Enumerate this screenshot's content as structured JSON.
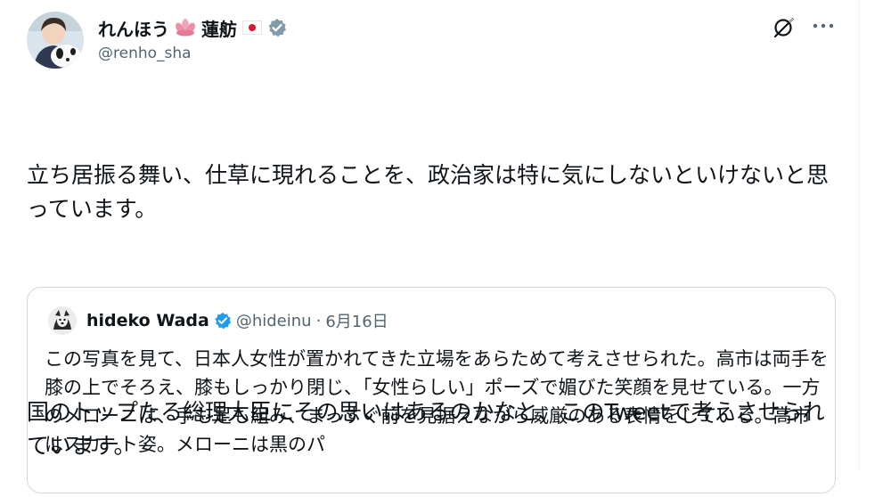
{
  "author": {
    "display_name": "れんほう",
    "display_name_kanji": "蓮舫",
    "handle": "@renho_sha"
  },
  "tweet": {
    "paragraphs": [
      "立ち居振る舞い、仕草に現れることを、政治家は特に気にしないといけないと思っています。",
      "国のトップたる総理大臣にその思いはあるのかなと、このTweetで考えさせられています。"
    ]
  },
  "quoted": {
    "display_name": "hideko Wada",
    "handle": "@hideinu",
    "separator": "·",
    "date": "6月16日",
    "text": "この写真を見て、日本人女性が置かれてきた立場をあらためて考えさせられた。高市は両手を膝の上でそろえ、膝もしっかり閉じ、「女性らしい」ポーズで媚びた笑顔を見せている。一方のメローニは、手も足も組み、まっすぐ前を見据えながら威厳のある表情をしている。高市はスカート姿。メローニは黒のパ"
  },
  "icons": {
    "verified": "verified-badge-icon",
    "grok": "grok-icon",
    "more": "more-options-icon",
    "lotus": "lotus-emoji-icon",
    "flag": "japan-flag-emoji-icon"
  },
  "colors": {
    "verified_badge": "#829aab",
    "quoted_verified_badge": "#1d9bf0",
    "secondary_text": "#536471",
    "border": "#cfd9de"
  }
}
